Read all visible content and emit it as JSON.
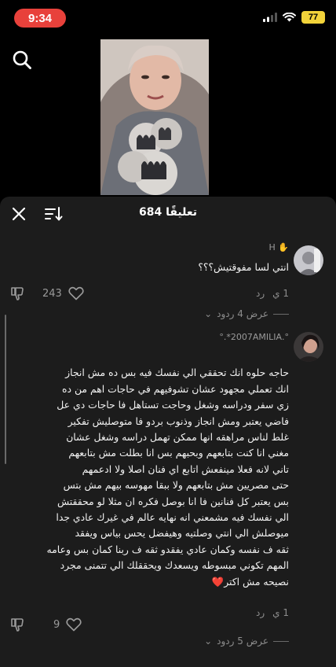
{
  "status_bar": {
    "time": "9:34",
    "battery": "77"
  },
  "comments_header": {
    "title": "684 تعليقًا"
  },
  "comments": [
    {
      "username": "H",
      "text": "انتي لسا مفوقتيش؟؟؟",
      "time": "1 ي",
      "reply_label": "رد",
      "likes": "243",
      "view_replies": "عرض 4 ردود"
    },
    {
      "username": "°.2007AMILIA*.°",
      "text": "حاجه حلوه انك تحققي الي نفسك فيه بس ده مش انجاز\nانك تعملي مجهود عشان تشوفيهم في حاجات اهم من ده\nزي سفر ودراسه وشغل وحاجت تستاهل فا حاجات دي عل\nفاضي يعتبر ومش انجاز وذنوب بردو فا متوصليش تفكير\nغلط لناس مراهقه انها ممكن تهمل دراسه وشغل عشان\nمغني انا كنت بتابعهم وبحبهم بس انا بطلت مش بتابعهم\nتاني لانه فعلا مينفعش اتابع اي فنان اصلا ولا ادعمهم\nحتى مصريين مش بتابعهم ولا ببقا مهوسه بيهم مش بتس\nبس يعتبر كل فنانين فا انا بوصل فكره ان مثلا لو محققتش\nالي نفسك فيه مشمعني انه نهايه عالم في غيرك عادي جدا\nميوصلش الي انتي وصلتيه وهيفضل يحس بياس ويفقد\nثقه ف نفسه وكمان عادي يفقدو ثقه ف ربنا كمان بس وعامه\nالمهم تكوني مبسوطه ويسعدك ويحققلك الي تتمنى مجرد\nنصيحه مش اكتر",
      "emoji": "❤️",
      "time": "1 ي",
      "reply_label": "رد",
      "likes": "9",
      "view_replies": "عرض 5 ردود"
    }
  ],
  "colors": {
    "time_pill": "#e8413b",
    "battery": "#f2d33a",
    "sheet": "#1c1c1c",
    "heart": "#e8202a"
  }
}
